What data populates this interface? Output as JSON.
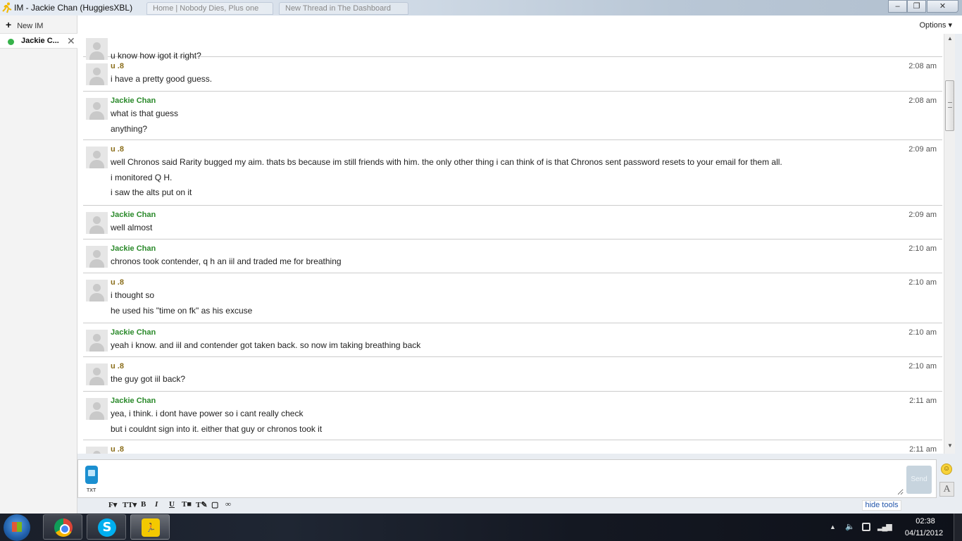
{
  "window": {
    "title": "IM - Jackie Chan (HuggiesXBL)",
    "background_tabs": [
      "Home | Nobody Dies, Plus one",
      "New Thread in The Dashboard"
    ],
    "minimize": "–",
    "maximize": "❐",
    "close": "✕"
  },
  "sidebar": {
    "new_im_label": "New IM",
    "contact": {
      "name": "Jackie C...",
      "status_color": "#36b24a",
      "close": "✕"
    }
  },
  "topbar": {
    "options_label": "Options ▾"
  },
  "colors": {
    "self_name": "#2b8a2b",
    "buddy_name": "#8a6d1a",
    "accent": "#2255aa"
  },
  "messages": [
    {
      "sender": "",
      "time": "",
      "lines": [
        "u know how igot it right?"
      ]
    },
    {
      "sender": "u .8",
      "time": "2:08 am",
      "lines": [
        "i have a pretty good guess."
      ]
    },
    {
      "sender": "Jackie Chan",
      "time": "2:08 am",
      "lines": [
        "what is that guess",
        "anything?"
      ]
    },
    {
      "sender": "u .8",
      "time": "2:09 am",
      "lines": [
        "well Chronos said Rarity bugged my aim. thats bs because im still friends with him. the only other thing i can think of is that Chronos sent password resets to your email for them all.",
        "i monitored Q H.",
        "i saw the alts put on it"
      ]
    },
    {
      "sender": "Jackie Chan",
      "time": "2:09 am",
      "lines": [
        "well almost"
      ]
    },
    {
      "sender": "Jackie Chan",
      "time": "2:10 am",
      "lines": [
        "chronos took contender, q h an iil and traded me for breathing"
      ]
    },
    {
      "sender": "u .8",
      "time": "2:10 am",
      "lines": [
        "i thought so",
        "he used his \"time on fk\" as his excuse"
      ]
    },
    {
      "sender": "Jackie Chan",
      "time": "2:10 am",
      "lines": [
        "yeah i know. and iil and contender got taken back. so now im taking breathing back"
      ]
    },
    {
      "sender": "u .8",
      "time": "2:10 am",
      "lines": [
        "the guy got iil back?"
      ]
    },
    {
      "sender": "Jackie Chan",
      "time": "2:11 am",
      "lines": [
        "yea, i think. i dont have power so i cant really check",
        "but i couldnt sign into it. either that guy or chronos took it"
      ]
    },
    {
      "sender": "u .8",
      "time": "2:11 am",
      "lines": []
    }
  ],
  "compose": {
    "txt_label": "TXT",
    "input_value": "",
    "send_label": "Send",
    "smiley": "☺",
    "font_label": "A"
  },
  "toolbar": {
    "font": "F▾",
    "size": "TT▾",
    "bold": "B",
    "italic": "I",
    "underline": "U",
    "text_color": "T■",
    "highlight": "T✎",
    "background": "▢",
    "link": "∞",
    "hide_tools": "hide tools"
  },
  "taskbar": {
    "skype_letter": "S",
    "aim_letter": "🏃",
    "tray_arrow": "▲",
    "volume": "🔈",
    "network": "▂▄▆",
    "clock_time": "02:38",
    "clock_date": "04/11/2012"
  }
}
